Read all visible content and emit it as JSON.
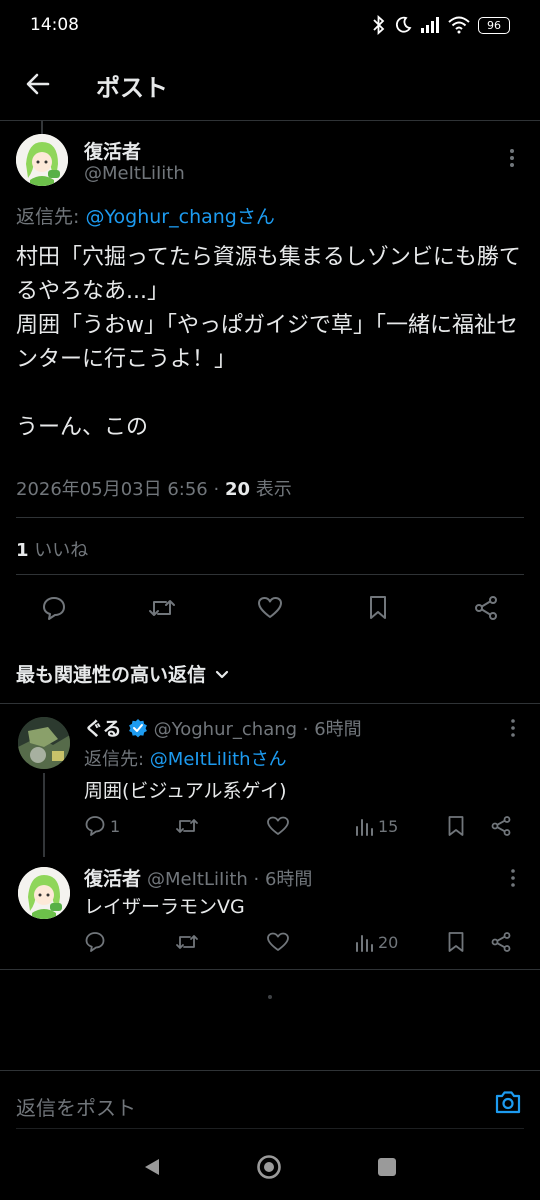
{
  "status": {
    "time": "14:08",
    "battery": "96"
  },
  "header": {
    "title": "ポスト"
  },
  "post": {
    "author_name": "復活者",
    "author_handle": "@MeItLiIith",
    "reply_prefix": "返信先: ",
    "reply_to": "@Yoghur_chang",
    "reply_suffix": "さん",
    "text": "村田「穴掘ってたら資源も集まるしゾンビにも勝てるやろなあ...」\n周囲「うおw」「やっぱガイジで草」「一緒に福祉センターに行こうよ！」\n\nうーん、この",
    "timestamp": "2026年05月03日 6:56",
    "separator": "·",
    "views_count": "20",
    "views_label": "表示",
    "likes_count": "1",
    "likes_label": "いいね"
  },
  "replies_header": {
    "label": "最も関連性の高い返信"
  },
  "replies": [
    {
      "name": "ぐる",
      "handle": "@Yoghur_chang · 6時間",
      "reply_prefix": "返信先: ",
      "reply_to": "@MeItLiIith",
      "reply_suffix": "さん",
      "text": "周囲(ビジュアル系ゲイ)",
      "reply_count": "1",
      "views": "15"
    },
    {
      "name": "復活者",
      "handle": "@MeItLiIith · 6時間",
      "text": "レイザーラモンVG",
      "views": "20"
    }
  ],
  "composer": {
    "placeholder": "返信をポスト"
  },
  "colors": {
    "accent": "#1d9bf0",
    "background": "#000000",
    "text": "#e7e9ea",
    "muted": "#71767b"
  }
}
